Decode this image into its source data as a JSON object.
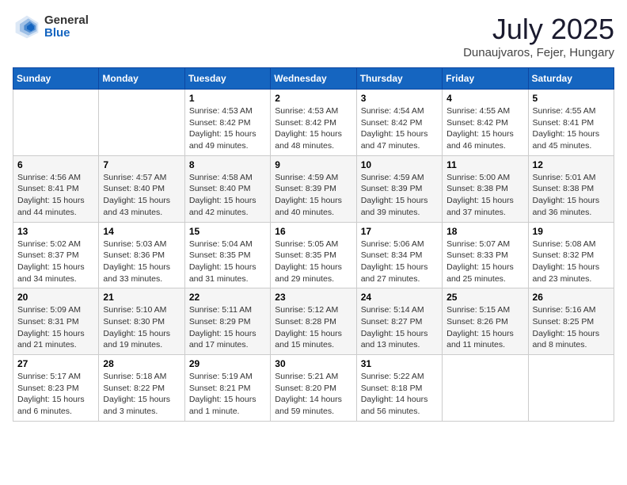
{
  "header": {
    "logo": {
      "general": "General",
      "blue": "Blue"
    },
    "title": "July 2025",
    "location": "Dunaujvaros, Fejer, Hungary"
  },
  "calendar": {
    "days_of_week": [
      "Sunday",
      "Monday",
      "Tuesday",
      "Wednesday",
      "Thursday",
      "Friday",
      "Saturday"
    ],
    "weeks": [
      [
        {
          "day": "",
          "info": ""
        },
        {
          "day": "",
          "info": ""
        },
        {
          "day": "1",
          "info": "Sunrise: 4:53 AM\nSunset: 8:42 PM\nDaylight: 15 hours and 49 minutes."
        },
        {
          "day": "2",
          "info": "Sunrise: 4:53 AM\nSunset: 8:42 PM\nDaylight: 15 hours and 48 minutes."
        },
        {
          "day": "3",
          "info": "Sunrise: 4:54 AM\nSunset: 8:42 PM\nDaylight: 15 hours and 47 minutes."
        },
        {
          "day": "4",
          "info": "Sunrise: 4:55 AM\nSunset: 8:42 PM\nDaylight: 15 hours and 46 minutes."
        },
        {
          "day": "5",
          "info": "Sunrise: 4:55 AM\nSunset: 8:41 PM\nDaylight: 15 hours and 45 minutes."
        }
      ],
      [
        {
          "day": "6",
          "info": "Sunrise: 4:56 AM\nSunset: 8:41 PM\nDaylight: 15 hours and 44 minutes."
        },
        {
          "day": "7",
          "info": "Sunrise: 4:57 AM\nSunset: 8:40 PM\nDaylight: 15 hours and 43 minutes."
        },
        {
          "day": "8",
          "info": "Sunrise: 4:58 AM\nSunset: 8:40 PM\nDaylight: 15 hours and 42 minutes."
        },
        {
          "day": "9",
          "info": "Sunrise: 4:59 AM\nSunset: 8:39 PM\nDaylight: 15 hours and 40 minutes."
        },
        {
          "day": "10",
          "info": "Sunrise: 4:59 AM\nSunset: 8:39 PM\nDaylight: 15 hours and 39 minutes."
        },
        {
          "day": "11",
          "info": "Sunrise: 5:00 AM\nSunset: 8:38 PM\nDaylight: 15 hours and 37 minutes."
        },
        {
          "day": "12",
          "info": "Sunrise: 5:01 AM\nSunset: 8:38 PM\nDaylight: 15 hours and 36 minutes."
        }
      ],
      [
        {
          "day": "13",
          "info": "Sunrise: 5:02 AM\nSunset: 8:37 PM\nDaylight: 15 hours and 34 minutes."
        },
        {
          "day": "14",
          "info": "Sunrise: 5:03 AM\nSunset: 8:36 PM\nDaylight: 15 hours and 33 minutes."
        },
        {
          "day": "15",
          "info": "Sunrise: 5:04 AM\nSunset: 8:35 PM\nDaylight: 15 hours and 31 minutes."
        },
        {
          "day": "16",
          "info": "Sunrise: 5:05 AM\nSunset: 8:35 PM\nDaylight: 15 hours and 29 minutes."
        },
        {
          "day": "17",
          "info": "Sunrise: 5:06 AM\nSunset: 8:34 PM\nDaylight: 15 hours and 27 minutes."
        },
        {
          "day": "18",
          "info": "Sunrise: 5:07 AM\nSunset: 8:33 PM\nDaylight: 15 hours and 25 minutes."
        },
        {
          "day": "19",
          "info": "Sunrise: 5:08 AM\nSunset: 8:32 PM\nDaylight: 15 hours and 23 minutes."
        }
      ],
      [
        {
          "day": "20",
          "info": "Sunrise: 5:09 AM\nSunset: 8:31 PM\nDaylight: 15 hours and 21 minutes."
        },
        {
          "day": "21",
          "info": "Sunrise: 5:10 AM\nSunset: 8:30 PM\nDaylight: 15 hours and 19 minutes."
        },
        {
          "day": "22",
          "info": "Sunrise: 5:11 AM\nSunset: 8:29 PM\nDaylight: 15 hours and 17 minutes."
        },
        {
          "day": "23",
          "info": "Sunrise: 5:12 AM\nSunset: 8:28 PM\nDaylight: 15 hours and 15 minutes."
        },
        {
          "day": "24",
          "info": "Sunrise: 5:14 AM\nSunset: 8:27 PM\nDaylight: 15 hours and 13 minutes."
        },
        {
          "day": "25",
          "info": "Sunrise: 5:15 AM\nSunset: 8:26 PM\nDaylight: 15 hours and 11 minutes."
        },
        {
          "day": "26",
          "info": "Sunrise: 5:16 AM\nSunset: 8:25 PM\nDaylight: 15 hours and 8 minutes."
        }
      ],
      [
        {
          "day": "27",
          "info": "Sunrise: 5:17 AM\nSunset: 8:23 PM\nDaylight: 15 hours and 6 minutes."
        },
        {
          "day": "28",
          "info": "Sunrise: 5:18 AM\nSunset: 8:22 PM\nDaylight: 15 hours and 3 minutes."
        },
        {
          "day": "29",
          "info": "Sunrise: 5:19 AM\nSunset: 8:21 PM\nDaylight: 15 hours and 1 minute."
        },
        {
          "day": "30",
          "info": "Sunrise: 5:21 AM\nSunset: 8:20 PM\nDaylight: 14 hours and 59 minutes."
        },
        {
          "day": "31",
          "info": "Sunrise: 5:22 AM\nSunset: 8:18 PM\nDaylight: 14 hours and 56 minutes."
        },
        {
          "day": "",
          "info": ""
        },
        {
          "day": "",
          "info": ""
        }
      ]
    ]
  }
}
